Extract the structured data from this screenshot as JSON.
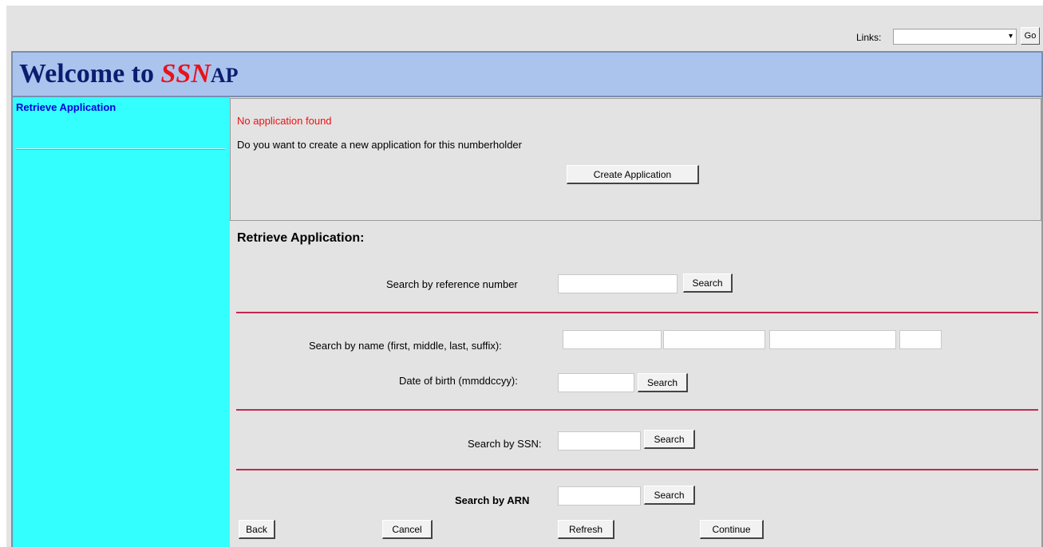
{
  "topbar": {
    "links_label": "Links:",
    "links_value": "",
    "go_label": "Go"
  },
  "header": {
    "title_prefix": "Welcome to ",
    "title_brand": "SSN",
    "title_suffix": "AP"
  },
  "sidebar": {
    "items": [
      {
        "label": "Retrieve Application"
      }
    ]
  },
  "notice": {
    "error": "No application found",
    "question": "Do you want to create a new application for this numberholder",
    "create_button": "Create Application"
  },
  "retrieve": {
    "heading": "Retrieve Application:",
    "ref_label": "Search by reference number",
    "ref_search": "Search",
    "name_label": "Search by name (first, middle, last, suffix):",
    "dob_label": "Date of birth (mmddccyy):",
    "dob_search": "Search",
    "ssn_label": "Search by SSN:",
    "ssn_search": "Search",
    "arn_label": "Search by ARN",
    "arn_search": "Search"
  },
  "footer": {
    "back": "Back",
    "cancel": "Cancel",
    "refresh": "Refresh",
    "continue": "Continue"
  },
  "colors": {
    "header_bg": "#aac4ee",
    "sidebar_bg": "#33ffff",
    "brand_red": "#e8131a",
    "divider": "#c3294d"
  }
}
